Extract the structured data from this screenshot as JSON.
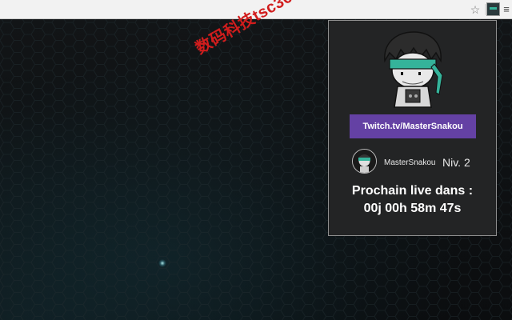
{
  "browser": {
    "star_icon": "star-icon",
    "extension_icon": "extension-icon",
    "menu_icon": "menu-icon"
  },
  "watermark": {
    "text": "数码科技tsc366"
  },
  "popup": {
    "twitch_link": "Twitch.tv/MasterSnakou",
    "username": "MasterSnakou",
    "level": "Niv. 2",
    "live_title": "Prochain live dans :",
    "countdown": "00j 00h 58m 47s",
    "colors": {
      "twitch": "#6441a4",
      "bandana": "#35b39a",
      "panel": "#232425"
    }
  }
}
